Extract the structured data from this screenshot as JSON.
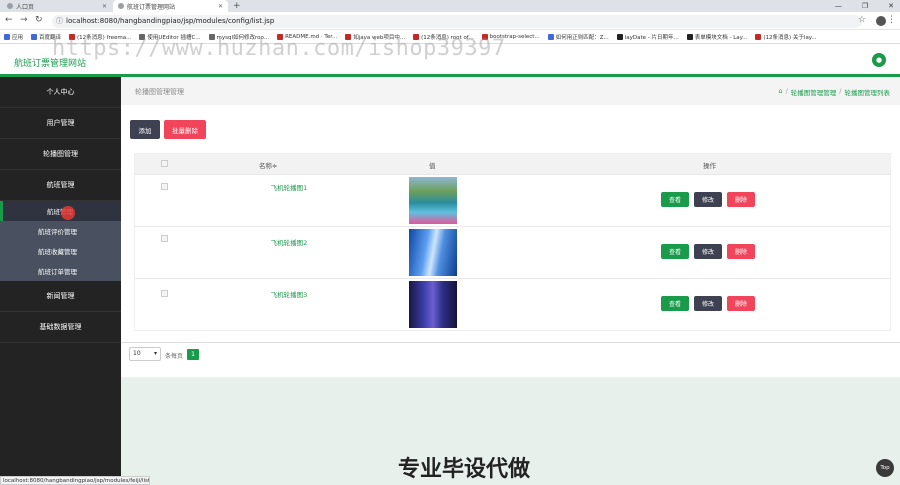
{
  "browser": {
    "tabs": [
      {
        "label": "人口页"
      },
      {
        "label": "航班订票管理网站"
      }
    ],
    "new_tab": "+",
    "url": "localhost:8080/hangbandingpiao/jsp/modules/config/list.jsp",
    "bookmarks": [
      {
        "label": "应用",
        "icon": "apps-icon"
      },
      {
        "label": "百度翻译",
        "icon": "baidu-icon"
      },
      {
        "label": "(12条消息) freema...",
        "icon": "csdn-icon"
      },
      {
        "label": "使用UEditor 插槽C...",
        "icon": "ueditor-icon"
      },
      {
        "label": "mysql如何修改roo...",
        "icon": "mysql-icon"
      },
      {
        "label": "README.md · Ter...",
        "icon": "gitee-icon"
      },
      {
        "label": "如java web项目中...",
        "icon": "csdn-icon"
      },
      {
        "label": "(12条消息) root of...",
        "icon": "csdn-icon"
      },
      {
        "label": "bootstrap-select...",
        "icon": "bootstrap-icon"
      },
      {
        "label": "如何用正则匹配：Z...",
        "icon": "site-icon"
      },
      {
        "label": "layDate - 片日期年...",
        "icon": "layui-icon"
      },
      {
        "label": "表单模块文档 - Lay...",
        "icon": "layui-icon"
      },
      {
        "label": "(12条消息) 关于lay...",
        "icon": "csdn-icon"
      }
    ],
    "status_url": "localhost:8080/hangbandingpiao/jsp/modules/feiji/list.jsp"
  },
  "header": {
    "site_title": "航班订票管理网站"
  },
  "sidebar": {
    "items": [
      {
        "label": "个人中心"
      },
      {
        "label": "用户管理"
      },
      {
        "label": "轮播图管理"
      },
      {
        "label": "航班管理"
      }
    ],
    "subitems": [
      {
        "label": "航班管理"
      },
      {
        "label": "航班评价管理"
      },
      {
        "label": "航班收藏管理"
      },
      {
        "label": "航班订单管理"
      }
    ],
    "items_after": [
      {
        "label": "新闻管理"
      },
      {
        "label": "基础数据管理"
      }
    ]
  },
  "main": {
    "page_title": "轮播图管理管理",
    "breadcrumb": [
      "轮播图管理管理",
      "轮播图管理列表"
    ],
    "add_label": "添加",
    "batch_delete_label": "批量删除",
    "columns": {
      "name": "名称≑",
      "value": "值",
      "action": "操作"
    },
    "rows": [
      {
        "name": "飞机轮播图1",
        "image": "img1"
      },
      {
        "name": "飞机轮播图2",
        "image": "img2"
      },
      {
        "name": "飞机轮播图3",
        "image": "img3"
      }
    ],
    "row_actions": {
      "view": "查看",
      "edit": "修改",
      "delete": "删除"
    },
    "pager": {
      "page_size": "10",
      "per_page_label": "条每页",
      "current_page": "1"
    }
  },
  "promo_text": "专业毕设代做",
  "top_button": "Top",
  "watermark": "https://www.huzhan.com/ishop39397",
  "colors": {
    "accent": "#1a9a4b",
    "danger": "#f0455b",
    "dark": "#3d4152",
    "sidebar": "#232323"
  }
}
